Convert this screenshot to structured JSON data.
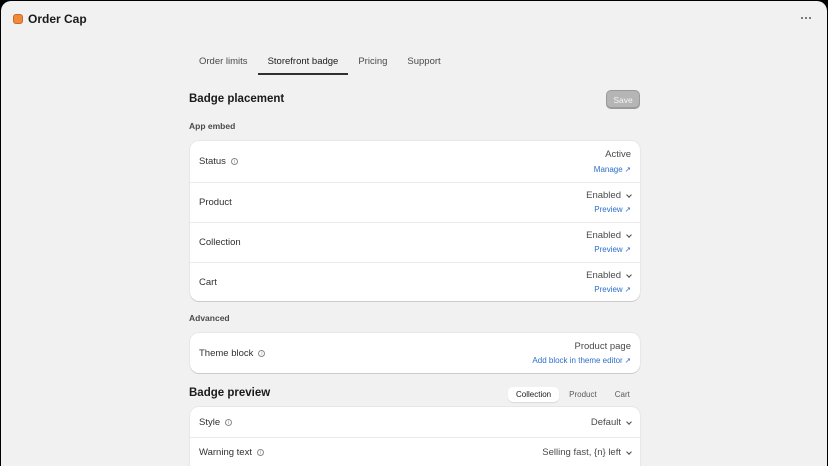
{
  "app": {
    "title": "Order Cap",
    "accent_color": "#f08a3a"
  },
  "tabs": [
    {
      "label": "Order limits"
    },
    {
      "label": "Storefront badge",
      "active": true
    },
    {
      "label": "Pricing"
    },
    {
      "label": "Support"
    }
  ],
  "badge_placement": {
    "title": "Badge placement",
    "save_label": "Save",
    "app_embed_label": "App embed",
    "rows": {
      "status": {
        "label": "Status",
        "value": "Active",
        "link": "Manage"
      },
      "product": {
        "label": "Product",
        "value": "Enabled",
        "link": "Preview"
      },
      "collection": {
        "label": "Collection",
        "value": "Enabled",
        "link": "Preview"
      },
      "cart": {
        "label": "Cart",
        "value": "Enabled",
        "link": "Preview"
      }
    },
    "advanced_label": "Advanced",
    "theme_block": {
      "label": "Theme block",
      "value": "Product page",
      "link": "Add block in theme editor"
    }
  },
  "badge_preview": {
    "title": "Badge preview",
    "segments": [
      {
        "label": "Collection",
        "active": true
      },
      {
        "label": "Product"
      },
      {
        "label": "Cart"
      }
    ],
    "style": {
      "label": "Style",
      "value": "Default"
    },
    "warning_text": {
      "label": "Warning text",
      "value": "Selling fast, {n} left"
    }
  },
  "icons": {
    "external": "↗",
    "info": "i"
  },
  "colors": {
    "link": "#2c6ecb",
    "save_disabled": "#b5b5b5"
  }
}
